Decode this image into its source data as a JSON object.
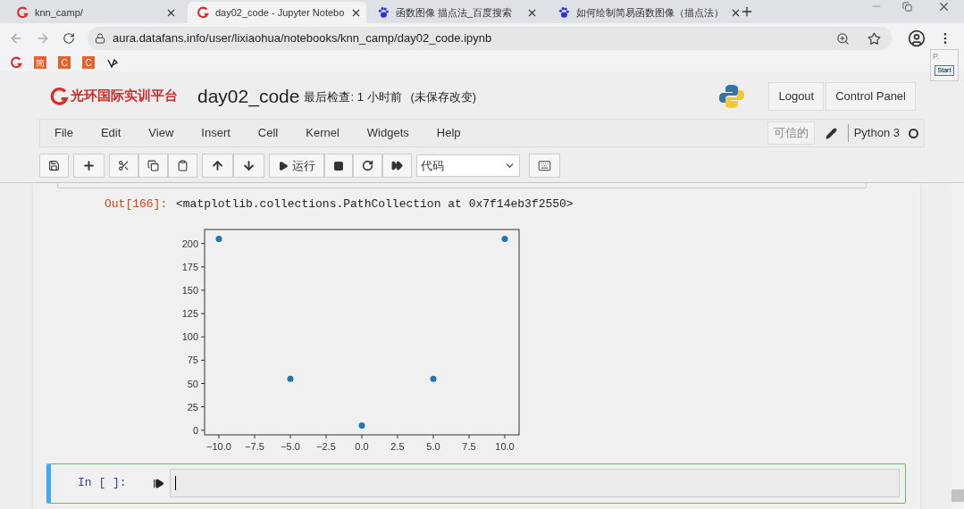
{
  "browser": {
    "tabs": [
      {
        "title": "knn_camp/",
        "kind": "logo",
        "selected": false
      },
      {
        "title": "day02_code - Jupyter Notebo",
        "kind": "logo",
        "selected": true
      },
      {
        "title": "函数图像 描点法_百度搜索",
        "kind": "paw",
        "selected": false
      },
      {
        "title": "如何绘制简易函数图像（描点法）",
        "kind": "paw",
        "selected": false
      }
    ],
    "url": "aura.datafans.info/user/lixiaohua/notebooks/knn_camp/day02_code.ipynb",
    "bookmarks": [
      {
        "kind": "logo"
      },
      {
        "kind": "letter",
        "text": "简"
      },
      {
        "kind": "letter",
        "text": "C"
      },
      {
        "kind": "letter",
        "text": "C"
      },
      {
        "kind": "glyph"
      }
    ]
  },
  "extension_popup": {
    "label": "P.",
    "button": "Start"
  },
  "header": {
    "logo_text": "光环国际实训平台",
    "notebook_name": "day02_code",
    "checkpoint": "最后检查: 1 小时前",
    "unsaved": "(未保存改变)",
    "buttons": [
      "Logout",
      "Control Panel"
    ]
  },
  "menu": {
    "items": [
      "File",
      "Edit",
      "View",
      "Insert",
      "Cell",
      "Kernel",
      "Widgets",
      "Help"
    ],
    "trusted": "可信的",
    "kernel": "Python 3",
    "kernel_busy": false
  },
  "toolbar": {
    "run_label": "运行",
    "cell_type": "代码"
  },
  "output": {
    "prompt": "Out[166]:",
    "text": "<matplotlib.collections.PathCollection at 0x7f14eb3f2550>",
    "chart_data": {
      "type": "scatter",
      "x": [
        -10,
        -5,
        0,
        5,
        10
      ],
      "series": [
        {
          "color": "#1f77b4",
          "values": [
            205,
            55,
            5,
            55,
            205
          ]
        }
      ],
      "xlim": [
        -11,
        11
      ],
      "ylim": [
        -5,
        215
      ],
      "xticks": [
        {
          "value": -10,
          "label": "−10.0"
        },
        {
          "value": -7.5,
          "label": "−7.5"
        },
        {
          "value": -5,
          "label": "−5.0"
        },
        {
          "value": -2.5,
          "label": "−2.5"
        },
        {
          "value": 0,
          "label": "0.0"
        },
        {
          "value": 2.5,
          "label": "2.5"
        },
        {
          "value": 5,
          "label": "5.0"
        },
        {
          "value": 7.5,
          "label": "7.5"
        },
        {
          "value": 10,
          "label": "10.0"
        }
      ],
      "yticks": [
        0,
        25,
        50,
        75,
        100,
        125,
        150,
        175,
        200
      ]
    }
  },
  "input_cell": {
    "prompt": "In [ ]:",
    "selected": true
  }
}
